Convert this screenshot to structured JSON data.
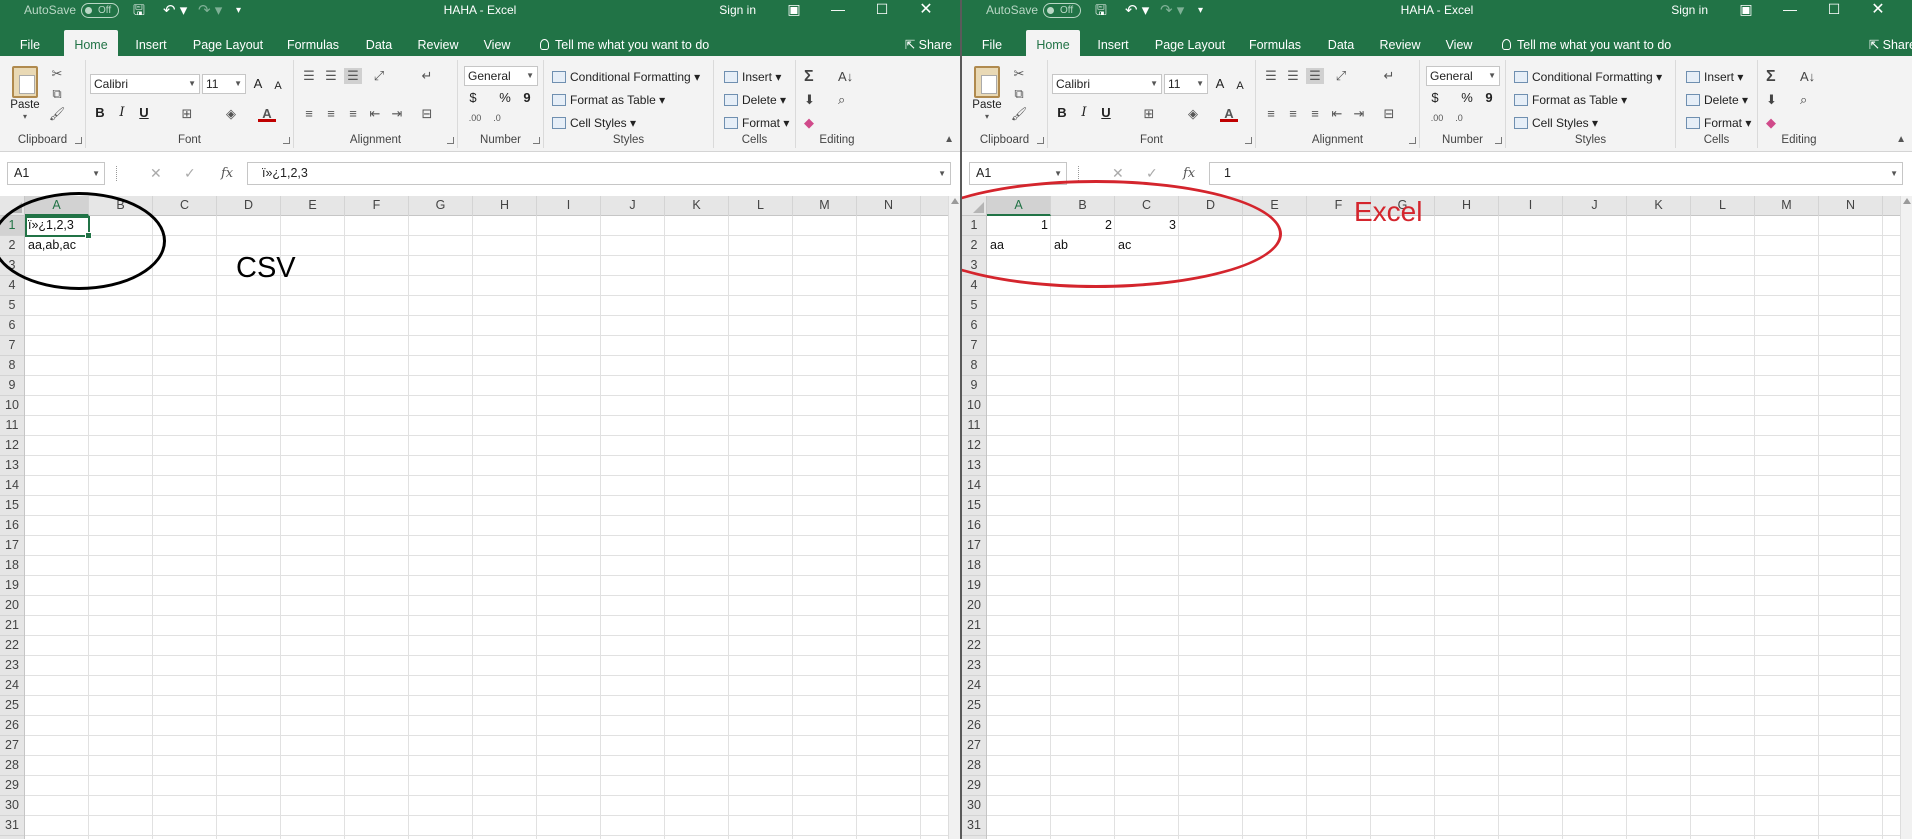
{
  "colors": {
    "excel_green": "#217346",
    "ribbon_bg": "#f3f3f3",
    "annot_black": "#000000",
    "annot_red": "#d4252d"
  },
  "windows": [
    {
      "titlebar": {
        "autosave": "AutoSave",
        "autosave_state": "Off",
        "title": "HAHA - Excel",
        "signin": "Sign in",
        "icons": {
          "save": "save-icon",
          "undo": "undo-icon",
          "redo": "redo-icon",
          "customize": "customize-qat-icon",
          "ribbon_display": "ribbon-display-icon",
          "minimize": "minimize-icon",
          "maximize": "maximize-icon",
          "close": "close-icon"
        }
      },
      "tabs": [
        "File",
        "Home",
        "Insert",
        "Page Layout",
        "Formulas",
        "Data",
        "Review",
        "View"
      ],
      "active_tab": "Home",
      "tell_me": "Tell me what you want to do",
      "share": "Share",
      "ribbon": {
        "clipboard": {
          "label": "Clipboard",
          "paste": "Paste"
        },
        "font": {
          "label": "Font",
          "name": "Calibri",
          "size": "11",
          "bold": "B",
          "italic": "I",
          "underline": "U",
          "grow": "A",
          "shrink": "A"
        },
        "alignment": {
          "label": "Alignment"
        },
        "number": {
          "label": "Number",
          "format": "General",
          "currency": "$",
          "percent": "%",
          "comma": "9"
        },
        "styles": {
          "label": "Styles",
          "conditional": "Conditional Formatting",
          "table": "Format as Table",
          "cell_styles": "Cell Styles"
        },
        "cells": {
          "label": "Cells",
          "insert": "Insert",
          "delete": "Delete",
          "format": "Format"
        },
        "editing": {
          "label": "Editing",
          "autosum": "Σ"
        }
      },
      "formula_bar": {
        "name_box": "A1",
        "fx": "fx",
        "value": "ï»¿1,2,3"
      },
      "sheet": {
        "columns": [
          "A",
          "B",
          "C",
          "D",
          "E",
          "F",
          "G",
          "H",
          "I",
          "J",
          "K",
          "L",
          "M",
          "N"
        ],
        "rows": [
          "1",
          "2",
          "3",
          "4",
          "5",
          "6",
          "7",
          "8",
          "9",
          "10",
          "11",
          "12",
          "13",
          "14",
          "15",
          "16",
          "17",
          "18",
          "19",
          "20",
          "21",
          "22",
          "23",
          "24",
          "25",
          "26",
          "27",
          "28",
          "29",
          "30",
          "31"
        ],
        "cells": [
          {
            "ref": "A1",
            "value": "ï»¿1,2,3"
          },
          {
            "ref": "A2",
            "value": "aa,ab,ac"
          }
        ]
      },
      "annotation": "CSV"
    },
    {
      "titlebar": {
        "autosave": "AutoSave",
        "autosave_state": "Off",
        "title": "HAHA - Excel",
        "signin": "Sign in",
        "icons": {
          "save": "save-icon",
          "undo": "undo-icon",
          "redo": "redo-icon",
          "customize": "customize-qat-icon",
          "ribbon_display": "ribbon-display-icon",
          "minimize": "minimize-icon",
          "maximize": "maximize-icon",
          "close": "close-icon"
        }
      },
      "tabs": [
        "File",
        "Home",
        "Insert",
        "Page Layout",
        "Formulas",
        "Data",
        "Review",
        "View"
      ],
      "active_tab": "Home",
      "tell_me": "Tell me what you want to do",
      "share": "Share",
      "ribbon": {
        "clipboard": {
          "label": "Clipboard",
          "paste": "Paste"
        },
        "font": {
          "label": "Font",
          "name": "Calibri",
          "size": "11",
          "bold": "B",
          "italic": "I",
          "underline": "U",
          "grow": "A",
          "shrink": "A"
        },
        "alignment": {
          "label": "Alignment"
        },
        "number": {
          "label": "Number",
          "format": "General",
          "currency": "$",
          "percent": "%",
          "comma": "9"
        },
        "styles": {
          "label": "Styles",
          "conditional": "Conditional Formatting",
          "table": "Format as Table",
          "cell_styles": "Cell Styles"
        },
        "cells": {
          "label": "Cells",
          "insert": "Insert",
          "delete": "Delete",
          "format": "Format"
        },
        "editing": {
          "label": "Editing",
          "autosum": "Σ"
        }
      },
      "formula_bar": {
        "name_box": "A1",
        "fx": "fx",
        "value": "1"
      },
      "sheet": {
        "columns": [
          "A",
          "B",
          "C",
          "D",
          "E",
          "F",
          "G",
          "H",
          "I",
          "J",
          "K",
          "L",
          "M",
          "N"
        ],
        "rows": [
          "1",
          "2",
          "3",
          "4",
          "5",
          "6",
          "7",
          "8",
          "9",
          "10",
          "11",
          "12",
          "13",
          "14",
          "15",
          "16",
          "17",
          "18",
          "19",
          "20",
          "21",
          "22",
          "23",
          "24",
          "25",
          "26",
          "27",
          "28",
          "29",
          "30",
          "31"
        ],
        "cells": [
          {
            "ref": "A1",
            "value": "1"
          },
          {
            "ref": "B1",
            "value": "2"
          },
          {
            "ref": "C1",
            "value": "3"
          },
          {
            "ref": "A2",
            "value": "aa"
          },
          {
            "ref": "B2",
            "value": "ab"
          },
          {
            "ref": "C2",
            "value": "ac"
          }
        ]
      },
      "annotation": "Excel"
    }
  ]
}
